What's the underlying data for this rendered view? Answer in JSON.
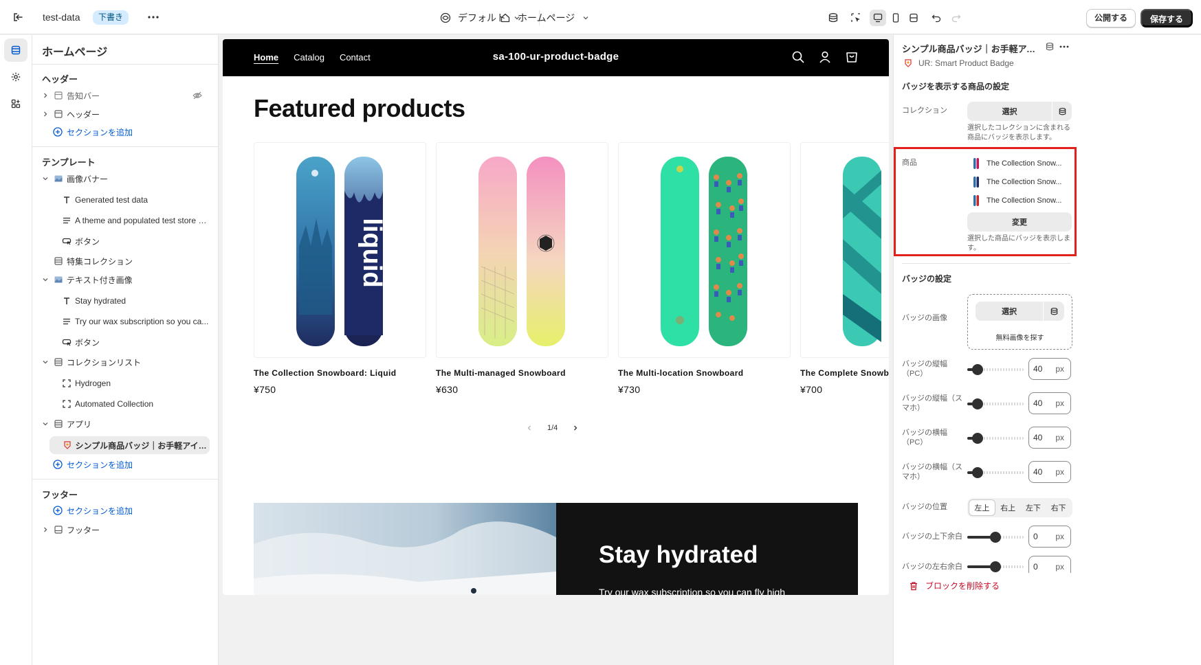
{
  "topbar": {
    "store_name": "test-data",
    "status_badge": "下書き",
    "theme_label": "デフォルト",
    "page_label": "ホームページ",
    "publish_label": "公開する",
    "save_label": "保存する"
  },
  "left_panel": {
    "title": "ホームページ",
    "header_group": {
      "heading": "ヘッダー",
      "items": [
        "告知バー",
        "ヘッダー"
      ],
      "add_label": "セクションを追加"
    },
    "template_group": {
      "heading": "テンプレート",
      "items": [
        "画像バナー",
        "Generated test data",
        "A theme and populated test store b...",
        "ボタン",
        "特集コレクション",
        "テキスト付き画像",
        "Stay hydrated",
        "Try our wax subscription so you ca...",
        "ボタン",
        "コレクションリスト",
        "Hydrogen",
        "Automated Collection",
        "アプリ",
        "シンプル商品バッジ｜お手軽アイコ..."
      ],
      "add_label": "セクションを追加"
    },
    "footer_group": {
      "heading": "フッター",
      "add_label": "セクションを追加",
      "items": [
        "フッター"
      ]
    }
  },
  "storefront": {
    "nav": [
      "Home",
      "Catalog",
      "Contact"
    ],
    "brand": "sa-100-ur-product-badge",
    "section_title": "Featured products",
    "products": [
      {
        "title": "The Collection Snowboard: Liquid",
        "price": "¥750"
      },
      {
        "title": "The Multi-managed Snowboard",
        "price": "¥630"
      },
      {
        "title": "The Multi-location Snowboard",
        "price": "¥730"
      },
      {
        "title": "The Complete Snowboard",
        "price": "¥700"
      }
    ],
    "pager": "1/4",
    "banner_heading": "Stay hydrated",
    "banner_text": "Try our wax subscription so you can fly high"
  },
  "right_panel": {
    "title": "シンプル商品バッジ｜お手軽アイ...",
    "app_name": "UR: Smart Product Badge",
    "section1_heading": "バッジを表示する商品の設定",
    "collection_label": "コレクション",
    "select_label": "選択",
    "collection_help": "選択したコレクションに含まれる商品にバッジを表示します。",
    "product_label": "商品",
    "products": [
      "The Collection Snow...",
      "The Collection Snow...",
      "The Collection Snow..."
    ],
    "change_label": "変更",
    "product_help": "選択した商品にバッジを表示します。",
    "section2_heading": "バッジの設定",
    "badge_image_label": "バッジの画像",
    "free_image_label": "無料画像を探す",
    "sliders": [
      {
        "label": "バッジの縦幅（PC）",
        "value": "40",
        "unit": "px",
        "level": 0.08
      },
      {
        "label": "バッジの縦幅（スマホ）",
        "value": "40",
        "unit": "px",
        "level": 0.08
      },
      {
        "label": "バッジの横幅（PC）",
        "value": "40",
        "unit": "px",
        "level": 0.08
      },
      {
        "label": "バッジの横幅（スマホ）",
        "value": "40",
        "unit": "px",
        "level": 0.08
      }
    ],
    "position_label": "バッジの位置",
    "positions": [
      "左上",
      "右上",
      "左下",
      "右下"
    ],
    "position_selected": "左上",
    "margin_v_label": "バッジの上下余白",
    "margin_v_value": "0",
    "margin_h_label": "バッジの左右余白",
    "margin_h_value": "0",
    "unit": "px",
    "delete_label": "ブロックを削除する"
  },
  "colors": {
    "accent_blue": "#005bd3",
    "highlight_red": "#e2201c",
    "delete_red": "#c70a24",
    "dark": "#303030"
  }
}
